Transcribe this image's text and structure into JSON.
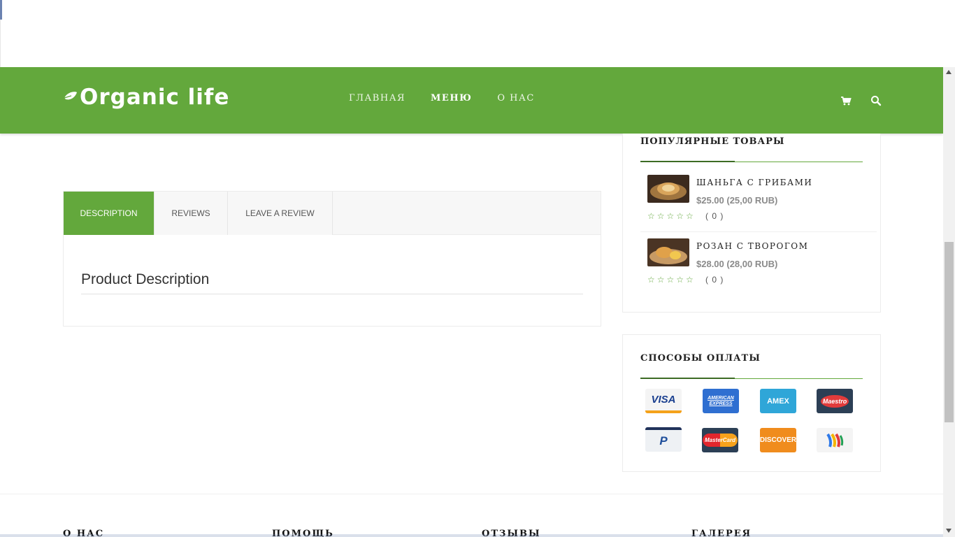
{
  "brand": {
    "logo_text": "Organic life"
  },
  "nav": {
    "items": [
      {
        "label": "ГЛАВНАЯ",
        "active": false
      },
      {
        "label": "МЕНЮ",
        "active": true
      },
      {
        "label": "О НАС",
        "active": false
      }
    ]
  },
  "header_icons": [
    "cart-icon",
    "search-icon"
  ],
  "colors": {
    "accent": "#63a83c",
    "accent_dark": "#3c6b24"
  },
  "tabs": [
    {
      "label": "DESCRIPTION",
      "active": true
    },
    {
      "label": "REVIEWS",
      "active": false
    },
    {
      "label": "LEAVE A REVIEW",
      "active": false
    }
  ],
  "description": {
    "title": "Product Description"
  },
  "popular": {
    "title": "ПОПУЛЯРНЫЕ ТОВАРЫ",
    "items": [
      {
        "name": "ШАНЬГА С ГРИБАМИ",
        "price": "$25.00 (25,00 RUB)",
        "rating": 0,
        "stars": "☆☆☆☆☆",
        "count": "( 0 )"
      },
      {
        "name": "РОЗАН С ТВОРОГОМ",
        "price": "$28.00 (28,00 RUB)",
        "rating": 0,
        "stars": "☆☆☆☆☆",
        "count": "( 0 )"
      }
    ]
  },
  "payment": {
    "title": "СПОСОБЫ ОПЛАТЫ",
    "cards": [
      {
        "name": "visa",
        "label": "VISA"
      },
      {
        "name": "american-express",
        "label": "AMERICAN EXPRESS"
      },
      {
        "name": "amex",
        "label": "AMEX"
      },
      {
        "name": "maestro",
        "label": "Maestro"
      },
      {
        "name": "paypal",
        "label": "P"
      },
      {
        "name": "mastercard",
        "label": "MasterCard"
      },
      {
        "name": "discover",
        "label": "DISCOVER"
      },
      {
        "name": "google-wallet",
        "label": ""
      }
    ]
  },
  "footer": {
    "columns": [
      "О НАС",
      "ПОМОЩЬ",
      "ОТЗЫВЫ",
      "ГАЛЕРЕЯ"
    ]
  }
}
